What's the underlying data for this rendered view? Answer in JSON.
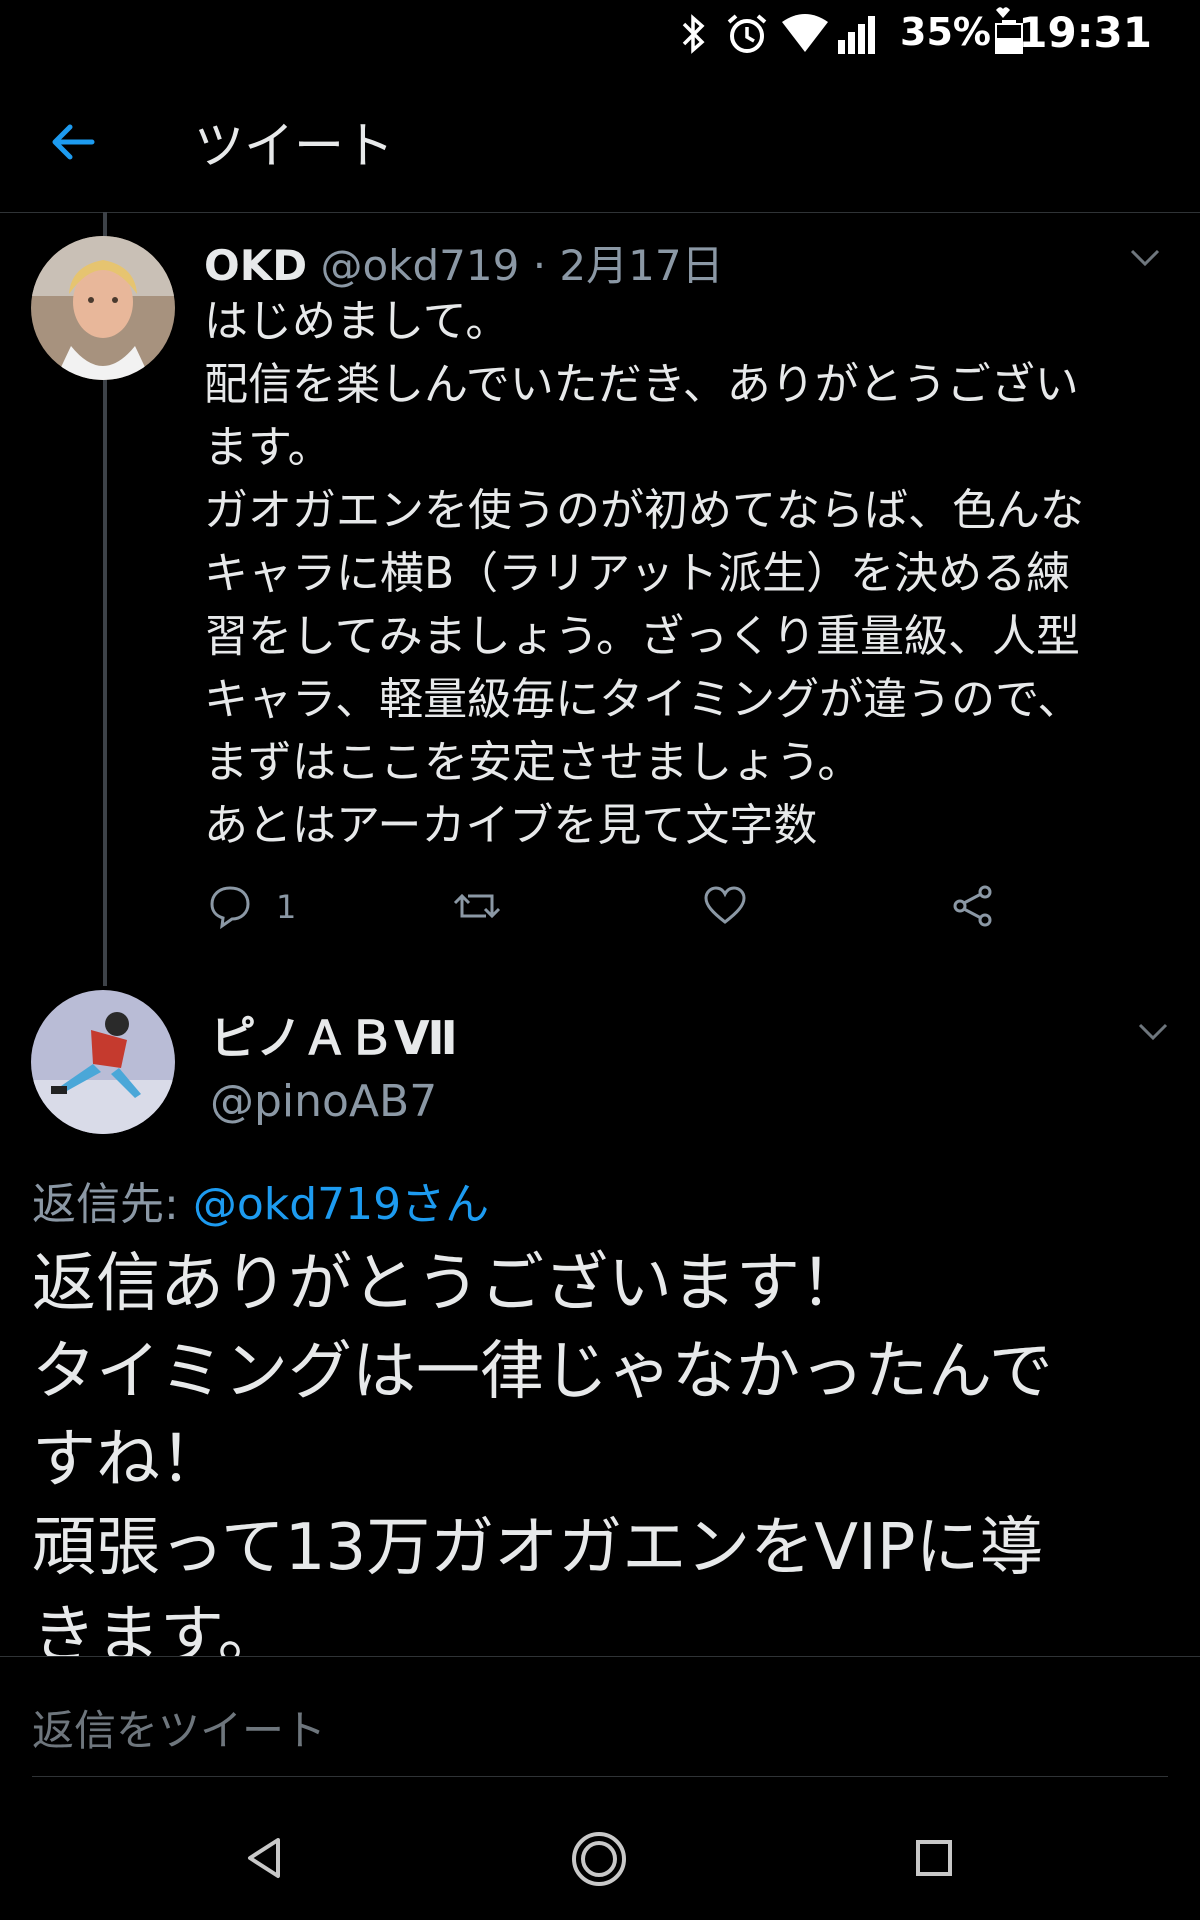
{
  "status_bar": {
    "battery_percent": "35%",
    "time": "19:31",
    "icons": [
      "bluetooth-icon",
      "alarm-icon",
      "wifi-icon",
      "signal-icon",
      "battery-icon"
    ]
  },
  "header": {
    "title": "ツイート"
  },
  "tweet1": {
    "name": "OKD",
    "handle": "@okd719",
    "separator": "·",
    "date": "2月17日",
    "text": "はじめまして。\n配信を楽しんでいただき、ありがとうござい\nます。\nガオガエンを使うのが初めてならば、色んな\nキャラに横B（ラリアット派生）を決める練\n習をしてみましょう。ざっくり重量級、人型\nキャラ、軽量級毎にタイミングが違うので、\nまずはここを安定させましょう。\nあとはアーカイブを見て文字数",
    "reply_count": "1"
  },
  "tweet2": {
    "name": "ピノＡＢⅦ",
    "handle": "@pinoAB7",
    "reply_to_label": "返信先: ",
    "reply_to_target": "@okd719さん",
    "text": "返信ありがとうございます！\nタイミングは一律じゃなかったんで\nすね！\n頑張って13万ガオガエンをVIPに導\nきます。"
  },
  "reply_bar": {
    "placeholder": "返信をツイート"
  },
  "colors": {
    "background": "#000000",
    "accent": "#1d9bf0",
    "text": "#e7e9ea",
    "secondary": "#8b98a5"
  }
}
